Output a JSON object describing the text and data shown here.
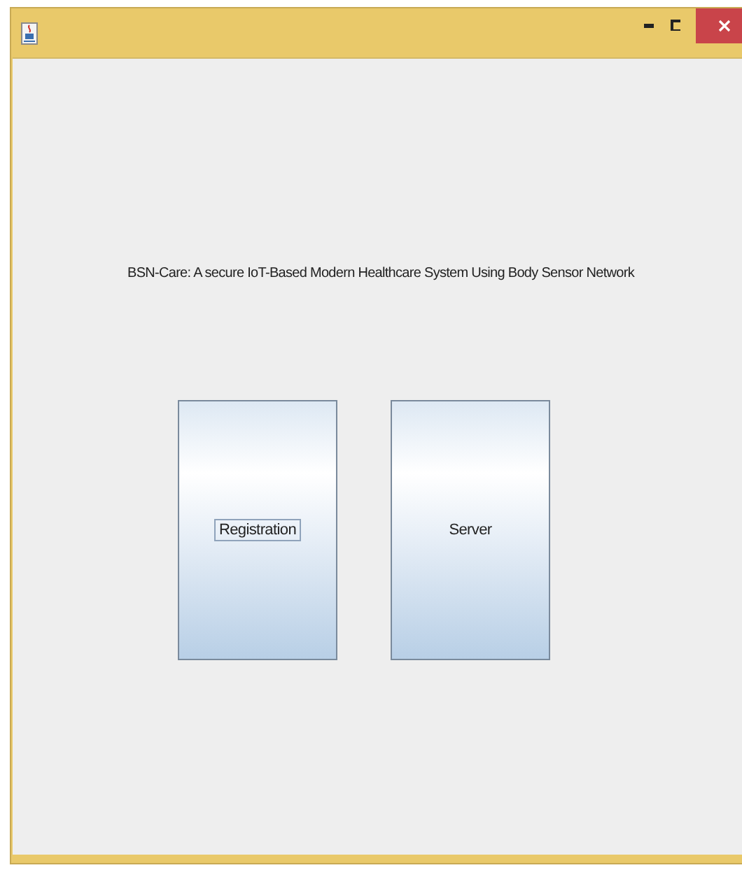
{
  "heading": "BSN-Care: A secure IoT-Based Modern Healthcare System Using Body Sensor Network",
  "buttons": [
    {
      "label": "Registration",
      "focused": true
    },
    {
      "label": "Server",
      "focused": false
    }
  ]
}
